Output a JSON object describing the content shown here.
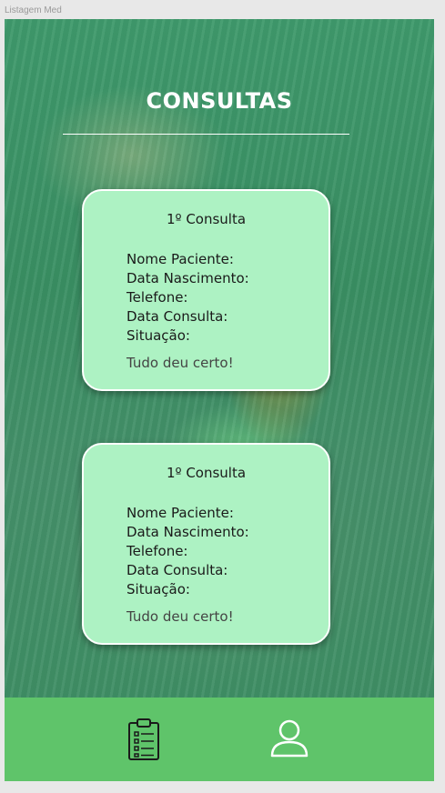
{
  "frame": {
    "label": "Listagem Med"
  },
  "header": {
    "title": "CONSULTAS"
  },
  "cards": [
    {
      "title": "1º  Consulta",
      "fields": {
        "patient_name": "Nome Paciente:",
        "birth_date": "Data Nascimento:",
        "phone": "Telefone:",
        "appointment_date": "Data Consulta:",
        "status": "Situação:"
      },
      "status_text": "Tudo deu certo!"
    },
    {
      "title": "1º  Consulta",
      "fields": {
        "patient_name": "Nome Paciente:",
        "birth_date": "Data Nascimento:",
        "phone": "Telefone:",
        "appointment_date": "Data Consulta:",
        "status": "Situação:"
      },
      "status_text": "Tudo deu certo!"
    }
  ],
  "bottom_nav": {
    "items": [
      {
        "icon": "clipboard-list-icon"
      },
      {
        "icon": "user-profile-icon"
      }
    ]
  },
  "colors": {
    "accent_green": "#5fc46a",
    "card_fill": "#adf2c3",
    "overlay_green": "#3f9a6c"
  }
}
